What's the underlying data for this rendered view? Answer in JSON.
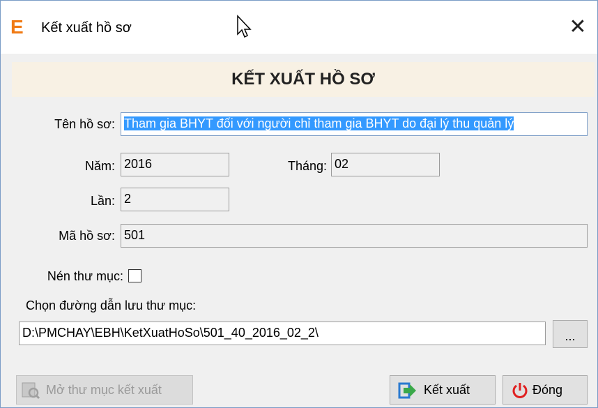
{
  "window": {
    "title": "Kết xuất hồ sơ",
    "app_icon_letter": "E",
    "close_glyph": "✕"
  },
  "header": {
    "title": "KẾT XUẤT HỒ SƠ"
  },
  "form": {
    "ten_ho_so": {
      "label": "Tên hồ sơ:",
      "value": "Tham gia BHYT đối với người chỉ tham gia BHYT do đại lý thu quản lý"
    },
    "nam": {
      "label": "Năm:",
      "value": "2016"
    },
    "thang": {
      "label": "Tháng:",
      "value": "02"
    },
    "lan": {
      "label": "Lần:",
      "value": "2"
    },
    "ma_ho_so": {
      "label": "Mã hồ sơ:",
      "value": "501"
    },
    "nen_thu_muc": {
      "label": "Nén thư mục:",
      "checked": false
    },
    "path": {
      "label": "Chọn đường dẫn lưu thư mục:",
      "value": "D:\\PMCHAY\\EBH\\KetXuatHoSo\\501_40_2016_02_2\\"
    },
    "browse_label": "..."
  },
  "buttons": {
    "open_folder": {
      "label": "Mở thư mục kết xuất",
      "enabled": false
    },
    "export": {
      "label": "Kết xuất"
    },
    "close": {
      "label": "Đóng"
    }
  },
  "colors": {
    "accent_orange": "#f07a14",
    "selection_blue": "#3399ff",
    "power_red": "#e02020",
    "export_green": "#3aa84a",
    "export_blue": "#2a7ad0"
  }
}
